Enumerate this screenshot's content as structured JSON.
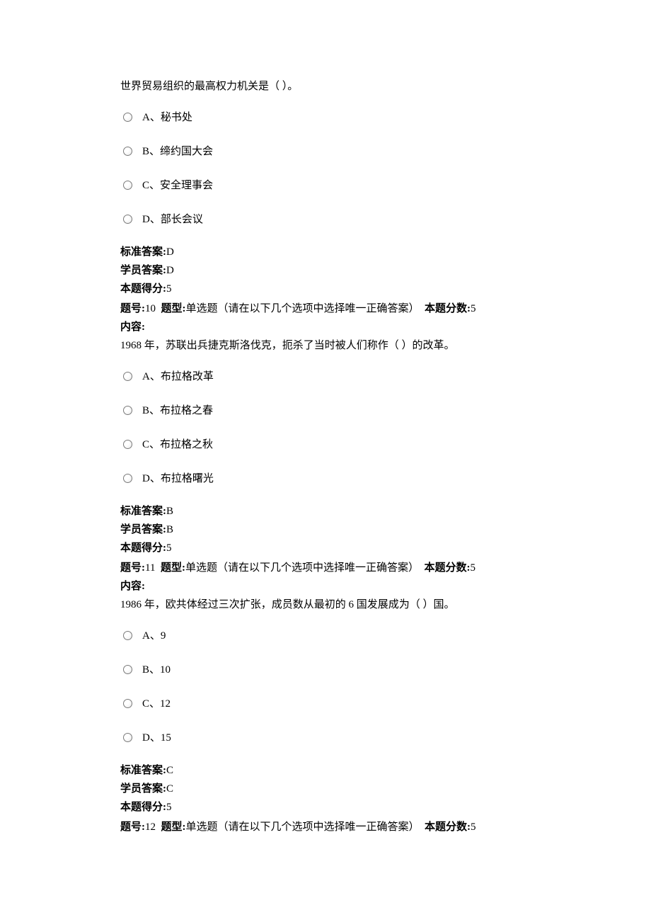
{
  "labels": {
    "standardAnswer": "标准答案:",
    "studentAnswer": "学员答案:",
    "pointsGot": "本题得分:",
    "qnum": "题号:",
    "qtype": "题型:",
    "qtypeValue": "单选题（请在以下几个选项中选择唯一正确答案）",
    "qscoreLabel": "本题分数:",
    "content": "内容:"
  },
  "q9": {
    "stem": "世界贸易组织的最高权力机关是（ ）。",
    "optA": "A、秘书处",
    "optB": "B、缔约国大会",
    "optC": "C、安全理事会",
    "optD": "D、部长会议",
    "stdAns": "D",
    "stuAns": "D",
    "gotPoints": "5"
  },
  "q10": {
    "num": "10",
    "score": "5",
    "stem": "1968 年，苏联出兵捷克斯洛伐克，扼杀了当时被人们称作（ ）的改革。",
    "optA": "A、布拉格改革",
    "optB": "B、布拉格之春",
    "optC": "C、布拉格之秋",
    "optD": "D、布拉格曙光",
    "stdAns": "B",
    "stuAns": "B",
    "gotPoints": "5"
  },
  "q11": {
    "num": "11",
    "score": "5",
    "stem": "1986 年，欧共体经过三次扩张，成员数从最初的 6 国发展成为（ ）国。",
    "optA": "A、9",
    "optB": "B、10",
    "optC": "C、12",
    "optD": "D、15",
    "stdAns": "C",
    "stuAns": "C",
    "gotPoints": "5"
  },
  "q12": {
    "num": "12",
    "score": "5"
  }
}
